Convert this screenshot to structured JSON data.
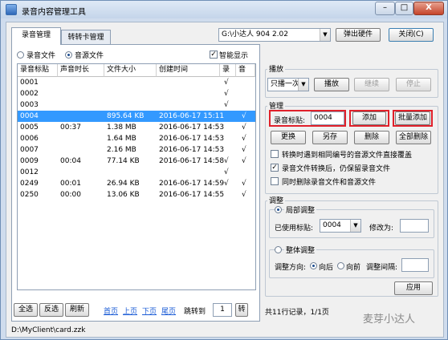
{
  "window": {
    "title": "录音内容管理工具",
    "min_label": "–",
    "max_label": "□",
    "close_label": "X"
  },
  "tabs": [
    {
      "label": "录音管理"
    },
    {
      "label": "转转卡管理"
    }
  ],
  "top": {
    "drive_value": "G:\\小达人 904 2.02",
    "eject_label": "弹出硬件",
    "close_label": "关闭(C)"
  },
  "filter": {
    "option_recording": "录音文件",
    "option_audio": "音源文件",
    "smart_display": "智能显示"
  },
  "table": {
    "headers": [
      "录音标贴",
      "声音时长",
      "文件大小",
      "创建时间",
      "录",
      "音"
    ],
    "rows": [
      {
        "id": "0001",
        "duration": "",
        "size": "",
        "created": "",
        "rec": "√",
        "src": ""
      },
      {
        "id": "0002",
        "duration": "",
        "size": "",
        "created": "",
        "rec": "√",
        "src": ""
      },
      {
        "id": "0003",
        "duration": "",
        "size": "",
        "created": "",
        "rec": "√",
        "src": ""
      },
      {
        "id": "0004",
        "duration": "",
        "size": "895.64 KB",
        "created": "2016-06-17 15:11",
        "rec": "",
        "src": "√"
      },
      {
        "id": "0005",
        "duration": "00:37",
        "size": "1.38 MB",
        "created": "2016-06-17 14:53",
        "rec": "",
        "src": "√"
      },
      {
        "id": "0006",
        "duration": "",
        "size": "1.64 MB",
        "created": "2016-06-17 14:53",
        "rec": "",
        "src": "√"
      },
      {
        "id": "0007",
        "duration": "",
        "size": "2.16 MB",
        "created": "2016-06-17 14:53",
        "rec": "",
        "src": "√"
      },
      {
        "id": "0009",
        "duration": "00:04",
        "size": "77.14 KB",
        "created": "2016-06-17 14:58",
        "rec": "√",
        "src": "√"
      },
      {
        "id": "0012",
        "duration": "",
        "size": "",
        "created": "",
        "rec": "√",
        "src": ""
      },
      {
        "id": "0249",
        "duration": "00:01",
        "size": "26.94 KB",
        "created": "2016-06-17 14:59",
        "rec": "√",
        "src": "√"
      },
      {
        "id": "0250",
        "duration": "00:00",
        "size": "13.06 KB",
        "created": "2016-06-17 14:55",
        "rec": "",
        "src": "√"
      }
    ]
  },
  "bottom": {
    "select_all": "全选",
    "invert": "反选",
    "refresh": "刷新",
    "first": "首页",
    "prev": "上页",
    "next": "下页",
    "last": "尾页",
    "jump_label": "跳转到",
    "page_value": "1",
    "go": "转",
    "summary": "共11行记录，1/1页"
  },
  "play": {
    "group_label": "播放",
    "mode_value": "只播一次",
    "play": "播放",
    "resume": "继续",
    "stop": "停止"
  },
  "manage": {
    "group_label": "管理",
    "label_caption": "录音标贴:",
    "label_value": "0004",
    "add": "添加",
    "batch_add": "批量添加",
    "replace": "更换",
    "save_as": "另存",
    "delete": "删除",
    "delete_all": "全部删除",
    "opt1": "转换时遇到相同编号的音源文件直接覆盖",
    "opt2": "录音文件转换后，仍保留录音文件",
    "opt3": "同时删除录音文件和音源文件"
  },
  "adjust": {
    "group_label": "调整",
    "local_label": "局部调整",
    "used_label": "已使用标贴:",
    "used_value": "0004",
    "modify_label": "修改为:",
    "global_label": "整体调整",
    "direction_label": "调整方向:",
    "backward": "向后",
    "forward": "向前",
    "interval_label": "调整间隔:",
    "apply": "应用"
  },
  "status": {
    "path": "D:\\MyClient\\card.zzk"
  },
  "watermark": {
    "text": "麦芽小达人"
  }
}
